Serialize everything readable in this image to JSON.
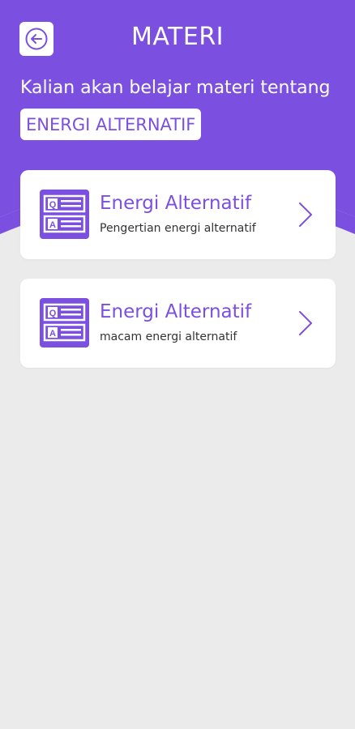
{
  "header": {
    "title": "MATERI",
    "intro": "Kalian akan belajar materi tentang",
    "topic": "ENERGI ALTERNATIF"
  },
  "materials": [
    {
      "title": "Energi Alternatif",
      "subtitle": "Pengertian energi alternatif"
    },
    {
      "title": "Energi Alternatif",
      "subtitle": "macam energi alternatif"
    }
  ],
  "icons": {
    "back": "back-arrow-icon",
    "card": "qa-icon",
    "chevron": "chevron-right-icon"
  },
  "colors": {
    "primary": "#7b4fe0",
    "background": "#ebebeb",
    "card": "#ffffff"
  }
}
